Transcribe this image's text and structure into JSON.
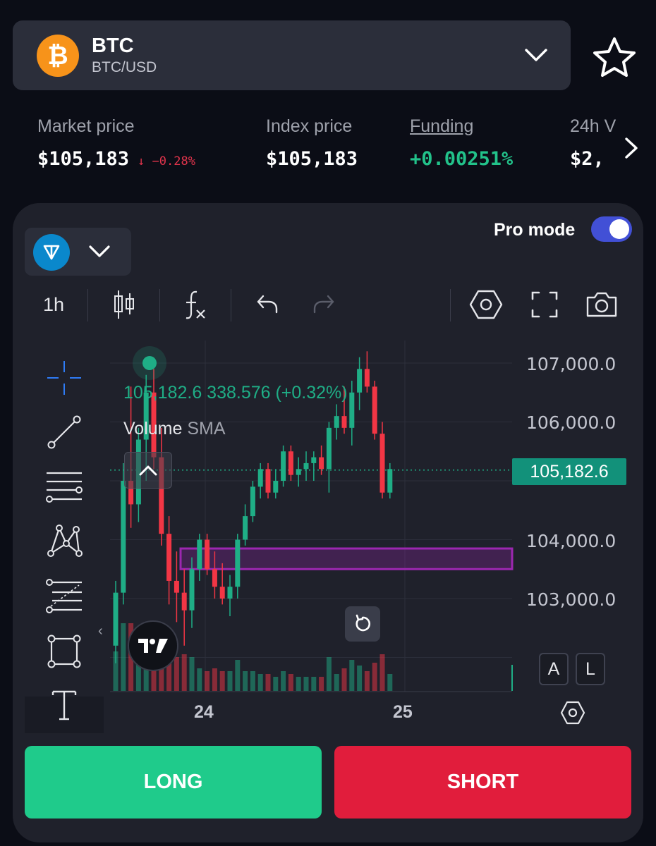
{
  "asset": {
    "symbol": "BTC",
    "pair": "BTC/USD",
    "logo_glyph": "₿"
  },
  "stats": {
    "market_label": "Market price",
    "market_value": "$105,183",
    "market_change": "↓ −0.28%",
    "index_label": "Index price",
    "index_value": "$105,183",
    "funding_label": "Funding",
    "funding_value": "+0.00251%",
    "volume_label": "24h V",
    "volume_value": "$2,"
  },
  "panel": {
    "pro_mode_label": "Pro mode",
    "pro_mode_on": true
  },
  "toolbar": {
    "timeframe": "1h"
  },
  "chart": {
    "ohlc_text": "105,182.6  338.576 (+0.32%)",
    "volume_label": "Volume",
    "volume_sma": "SMA",
    "y_ticks": [
      "107,000.0",
      "106,000.0",
      "104,000.0",
      "103,000.0"
    ],
    "current_price": "105,182.6",
    "x_ticks": [
      "24",
      "25"
    ],
    "scale_auto": "A",
    "scale_log": "L",
    "colors": {
      "up": "#1fae86",
      "down": "#f23645",
      "zone": "#9c27b0"
    }
  },
  "chart_data": {
    "type": "candlestick",
    "y_range": [
      102000,
      107500
    ],
    "y_ticks": [
      107000,
      106000,
      104000,
      103000
    ],
    "x_ticks": [
      "24",
      "25"
    ],
    "current_price": 105182.6,
    "zone": [
      103500,
      103850
    ]
  },
  "actions": {
    "long_label": "LONG",
    "short_label": "SHORT"
  }
}
